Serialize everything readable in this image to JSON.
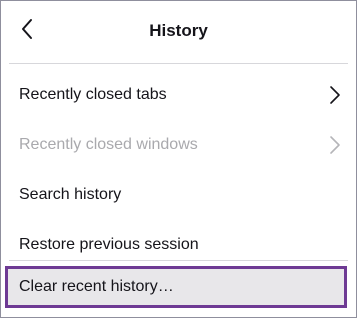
{
  "panel": {
    "title": "History",
    "back_icon": "chevron-left-icon"
  },
  "menu": {
    "items": [
      {
        "label": "Recently closed tabs",
        "has_submenu": true,
        "enabled": true,
        "icon": "chevron-right-icon"
      },
      {
        "label": "Recently closed windows",
        "has_submenu": true,
        "enabled": false,
        "icon": "chevron-right-icon"
      },
      {
        "label": "Search history",
        "has_submenu": false,
        "enabled": true
      },
      {
        "label": "Restore previous session",
        "has_submenu": false,
        "enabled": true
      }
    ],
    "clear": {
      "label": "Clear recent history…",
      "focused": true
    }
  },
  "colors": {
    "focus_border": "#6e3a94",
    "focus_background": "#e8e7ea",
    "disabled_text": "#a9a9ad",
    "text": "#15141a"
  }
}
